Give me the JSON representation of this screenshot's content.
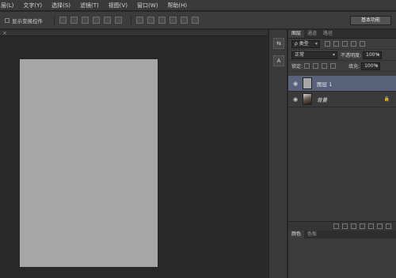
{
  "menu": {
    "items": [
      "层(L)",
      "文字(Y)",
      "选择(S)",
      "滤镜(T)",
      "视图(V)",
      "窗口(W)",
      "帮助(H)"
    ]
  },
  "options": {
    "show_transform_label": "显示变换控件",
    "workspace": "基本功能"
  },
  "layers_panel": {
    "tabs": [
      "图层",
      "通道",
      "路径"
    ],
    "filter_kind": "ρ 类型",
    "blend_mode": "正常",
    "opacity_label": "不透明度:",
    "opacity_value": "100%",
    "lock_label": "锁定:",
    "fill_label": "填充:",
    "fill_value": "100%",
    "layers": [
      {
        "name": "图层 1",
        "selected": true
      },
      {
        "name": "背景",
        "selected": false
      }
    ]
  },
  "bottom_panel": {
    "tabs": [
      "颜色",
      "色板"
    ]
  }
}
